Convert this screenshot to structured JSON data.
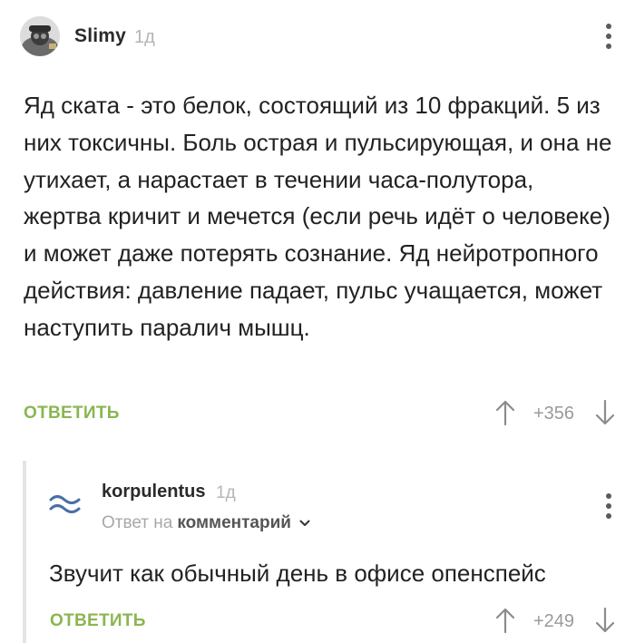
{
  "comment": {
    "author": "Slimy",
    "age": "1д",
    "body": "Яд ската - это белок, состоящий из 10 фракций. 5 из них токсичны. Боль острая и пульсирующая, и она не утихает, а нарастает в течении часа-полутора, жертва кричит и мечется (если речь идёт о человеке) и может даже потерять сознание. Яд нейротропного действия: давление падает, пульс учащается, может наступить паралич мышц.",
    "reply_label": "ОТВЕТИТЬ",
    "score": "+356"
  },
  "reply": {
    "author": "korpulentus",
    "age": "1д",
    "reply_to_prefix": "Ответ на",
    "reply_to_link": "комментарий",
    "body": "Звучит как обычный день в офисе опенспейс",
    "reply_label": "ОТВЕТИТЬ",
    "score": "+249"
  },
  "icons": {
    "menu": "more-vertical-icon",
    "upvote": "arrow-up-icon",
    "downvote": "arrow-down-icon",
    "expand": "chevron-down-icon"
  },
  "colors": {
    "accent_green": "#8ab650",
    "muted": "#b5b5b5",
    "text": "#222222"
  }
}
